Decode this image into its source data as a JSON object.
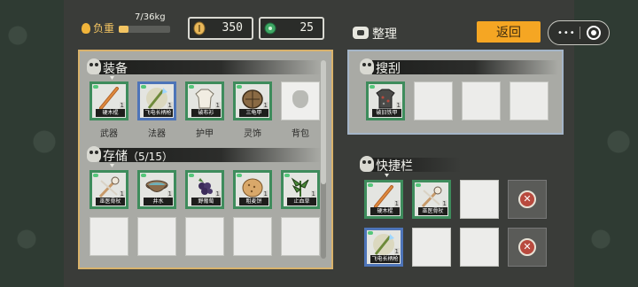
{
  "header": {
    "weight_label": "负重",
    "weight_text": "7/36kg",
    "weight_ratio": 0.194,
    "currency1": {
      "icon": "coin-icon",
      "value": "350",
      "color": "#e8b85a"
    },
    "currency2": {
      "icon": "gem-icon",
      "value": "25",
      "color": "#3fa865"
    },
    "organize_label": "整理",
    "back_label": "返回",
    "more_icon": "•••"
  },
  "equipment": {
    "title": "装备",
    "slots": [
      {
        "label": "武器",
        "item": "硬木棍",
        "level": "1",
        "icon": "wooden-stick-icon"
      },
      {
        "label": "法器",
        "item": "飞电长柄枪",
        "level": "1",
        "icon": "spear-icon"
      },
      {
        "label": "护甲",
        "item": "破布衫",
        "level": "1",
        "icon": "cloth-shirt-icon"
      },
      {
        "label": "灵饰",
        "item": "三龟甲",
        "level": "1",
        "icon": "turtle-shell-icon"
      },
      {
        "label": "背包",
        "item": "",
        "level": "",
        "icon": "bag-icon"
      }
    ]
  },
  "storage": {
    "title": "存储",
    "count": "（5/15）",
    "items": [
      {
        "item": "巫医骨杖",
        "level": "1",
        "icon": "bone-staff-icon"
      },
      {
        "item": "井水",
        "level": "1",
        "icon": "bowl-icon"
      },
      {
        "item": "野葡萄",
        "level": "1",
        "icon": "grape-icon"
      },
      {
        "item": "粗麦饼",
        "level": "1",
        "icon": "bread-icon"
      },
      {
        "item": "止血草",
        "level": "1",
        "icon": "herb-icon"
      }
    ]
  },
  "search": {
    "title": "搜刮",
    "items": [
      {
        "item": "破旧铁甲",
        "level": "1",
        "icon": "iron-armor-icon"
      }
    ]
  },
  "quickbar": {
    "title": "快捷栏",
    "items": [
      {
        "item": "硬木棍",
        "level": "1",
        "icon": "wooden-stick-icon"
      },
      {
        "item": "巫医骨杖",
        "level": "1",
        "icon": "bone-staff-icon"
      },
      {
        "item": "飞电长柄枪",
        "level": "1",
        "icon": "spear-icon"
      }
    ],
    "locked_icon": "close-icon"
  }
}
